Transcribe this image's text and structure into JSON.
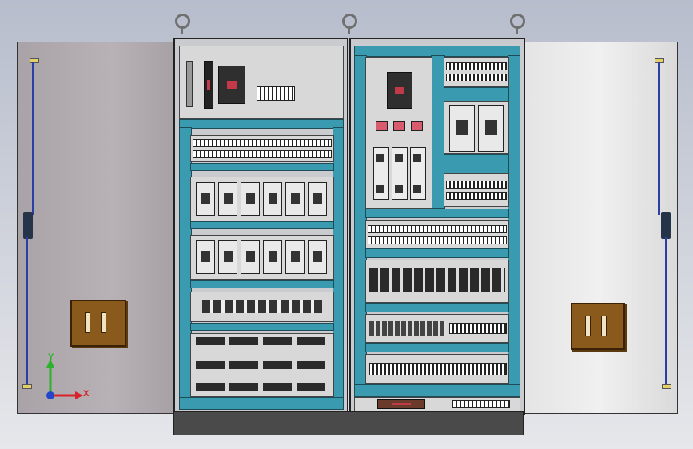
{
  "axis_triad": {
    "x_label": "X",
    "y_label": "Y",
    "x_color": "#d9232b",
    "y_color": "#2bb12b",
    "origin_color": "#2445c9"
  },
  "colors": {
    "cabinet_frame": "#3a9bb0",
    "left_door": "#b0aaae",
    "right_door": "#eaeaea",
    "door_handle": "#8a5a1c",
    "locking_rod": "#2a3ea8"
  }
}
